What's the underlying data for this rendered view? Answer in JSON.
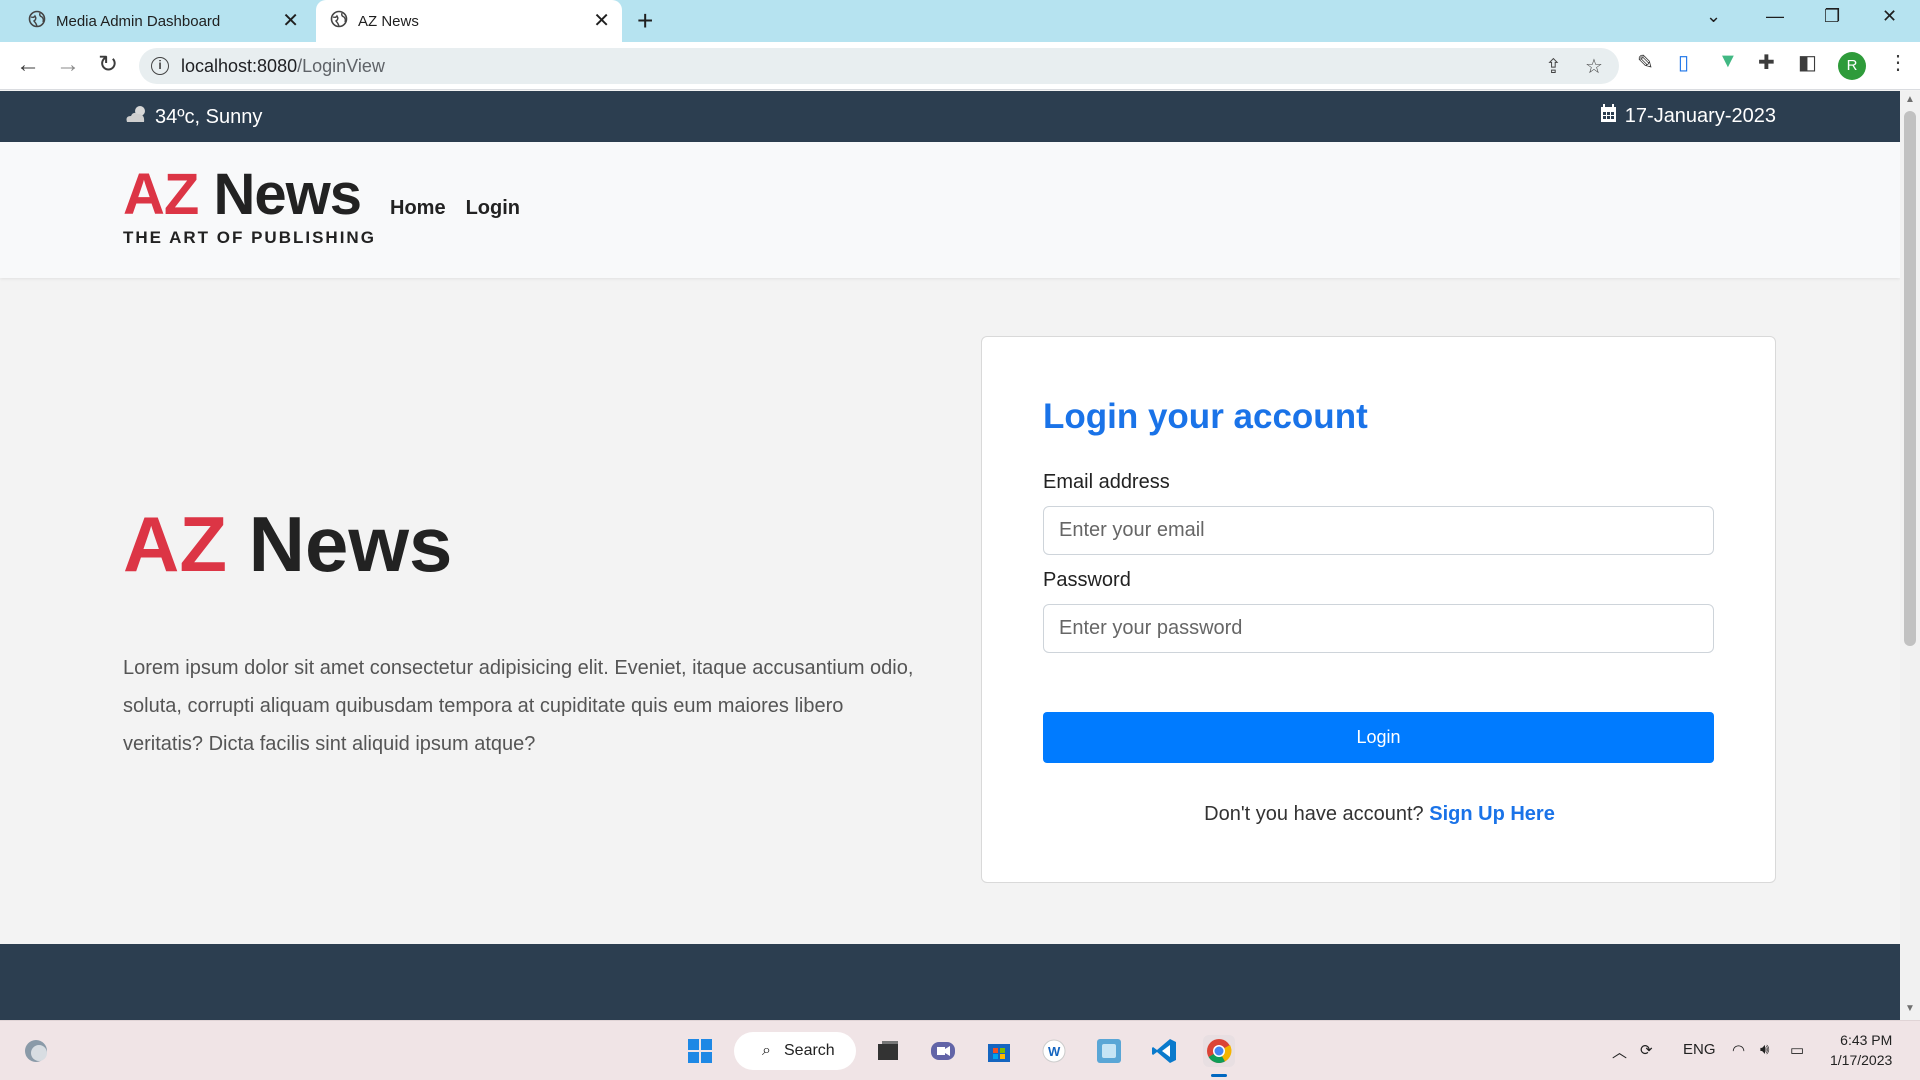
{
  "browser": {
    "tabs": [
      {
        "title": "Media Admin Dashboard"
      },
      {
        "title": "AZ News"
      }
    ],
    "url_host": "localhost:8080",
    "url_path": "/LoginView",
    "profile_initial": "R"
  },
  "topbar": {
    "weather": "34ºc, Sunny",
    "date": "17-January-2023"
  },
  "navbar": {
    "logo_az": "AZ",
    "logo_news": "News",
    "tagline": "THE ART OF PUBLISHING",
    "links": [
      "Home",
      "Login"
    ]
  },
  "hero": {
    "title_az": "AZ",
    "title_news": "News",
    "text": "Lorem ipsum dolor sit amet consectetur adipisicing elit. Eveniet, itaque accusantium odio, soluta, corrupti aliquam quibusdam tempora at cupiditate quis eum maiores libero veritatis? Dicta facilis sint aliquid ipsum atque?"
  },
  "login": {
    "title": "Login your account",
    "email_label": "Email address",
    "email_placeholder": "Enter your email",
    "password_label": "Password",
    "password_placeholder": "Enter your password",
    "button": "Login",
    "signup_prompt": "Don't you have account?",
    "signup_link": "Sign Up Here"
  },
  "taskbar": {
    "search": "Search",
    "language": "ENG",
    "time": "6:43 PM",
    "date": "1/17/2023"
  },
  "colors": {
    "brand_red": "#dc3545",
    "primary_blue": "#007bff",
    "dark_navy": "#2c3e50"
  }
}
